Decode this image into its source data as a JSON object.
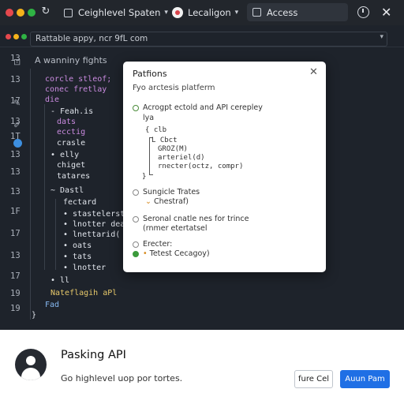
{
  "topbar": {
    "workspace": "Ceighlevel Spaten",
    "location": "Lecaligon",
    "access": "Access",
    "reload_icon": "reload-icon",
    "close_glyph": "✕"
  },
  "editor": {
    "url": "Rattable appy, ncr 9fL com",
    "hint": "A  wanniny fights",
    "line_numbers": [
      "13",
      "13",
      "17",
      "13",
      "1T",
      "13",
      "13",
      "13",
      "1F",
      "17",
      "13",
      "17",
      "19",
      "19"
    ],
    "code_lines": [
      {
        "text": "corcle stleof;",
        "color": "purple",
        "indent": 0
      },
      {
        "text": "conec fretlay",
        "color": "purple",
        "indent": 0
      },
      {
        "text": "die",
        "color": "purple",
        "indent": 0
      },
      {
        "text": "- Feah.is",
        "color": "white",
        "indent": 1
      },
      {
        "text": "dats",
        "color": "purple",
        "indent": 2
      },
      {
        "text": "ecctig",
        "color": "purple",
        "indent": 2
      },
      {
        "text": "crasle",
        "color": "white",
        "indent": 2
      },
      {
        "text": "• elly",
        "color": "white",
        "indent": 1
      },
      {
        "text": "chiget",
        "color": "white",
        "indent": 2
      },
      {
        "text": "tatares",
        "color": "white",
        "indent": 2
      },
      {
        "text": "~ Dastl",
        "color": "white",
        "indent": 1
      },
      {
        "text": "fectard",
        "color": "white",
        "indent": 3
      },
      {
        "text": "• stastelerstly",
        "color": "white",
        "indent": 3
      },
      {
        "text": "• lnotter deasl",
        "color": "white",
        "indent": 3
      },
      {
        "text": "• lnettarid(",
        "color": "white",
        "indent": 3
      },
      {
        "text": "• oats",
        "color": "white",
        "indent": 3
      },
      {
        "text": "• tats",
        "color": "white",
        "indent": 3
      },
      {
        "text": "• lnotter",
        "color": "white",
        "indent": 3
      },
      {
        "text": "• ll",
        "color": "white",
        "indent": 1
      },
      {
        "text": "Nateflagih aPl",
        "color": "yellow",
        "indent": 1
      },
      {
        "text": "Fad",
        "color": "blue",
        "indent": 0
      },
      {
        "text": "}",
        "color": "white",
        "indent": -1
      }
    ]
  },
  "dialog": {
    "title": "Patfions",
    "subtitle": "Fyo arctesis platferm",
    "option1_label": "Acrogpt ectold and API cerepley",
    "option1_sub": "lya",
    "code": [
      "{ clb",
      "L Cbct",
      "GROZ(M)",
      "arteriel(d)",
      "rnecter(octz, compr)"
    ],
    "close_brace": "}",
    "option2_label": "Sungicle Trates",
    "option2_sub": "Chestraf)",
    "option3_label": "Seronal cnatle nes for trince",
    "option3_sub": "(rnmer etertatsel",
    "option4_label": "Erecter:",
    "option4_sub": "Tetest Cecagoy)"
  },
  "notification": {
    "title": "Pasking API",
    "description": "Go highlevel uop por tortes.",
    "cancel_label": "fure Cel",
    "primary_label": "Auun Pam"
  },
  "colors": {
    "accent": "#1f6fe5",
    "traffic_red": "#e5484d",
    "traffic_yellow": "#f5b31b",
    "traffic_green": "#2fb344",
    "code_purple": "#c98adf",
    "code_yellow": "#e6c86a"
  }
}
